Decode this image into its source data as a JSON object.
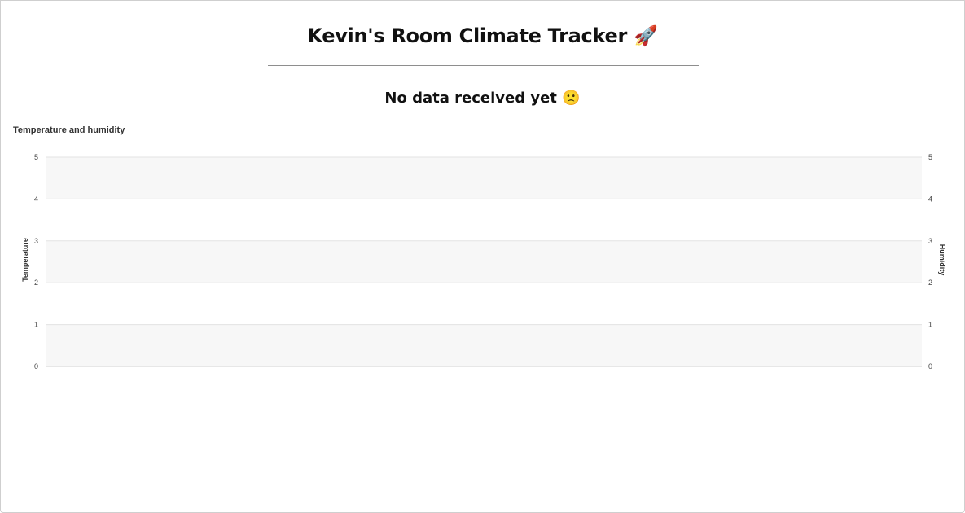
{
  "page": {
    "title": "Kevin's Room Climate Tracker 🚀",
    "status_message": "No data received yet 🙁"
  },
  "chart_data": {
    "type": "line",
    "title": "Temperature and humidity",
    "ylabel": "Temperature",
    "y2label": "Humidity",
    "ylim": [
      0,
      5
    ],
    "y2lim": [
      0,
      5
    ],
    "yticks": [
      "0",
      "1",
      "2",
      "3",
      "4",
      "5"
    ],
    "y2ticks": [
      "0",
      "1",
      "2",
      "3",
      "4",
      "5"
    ],
    "series": [],
    "grid": true,
    "band_colors": [
      "#f7f7f7",
      "#ffffff"
    ]
  }
}
